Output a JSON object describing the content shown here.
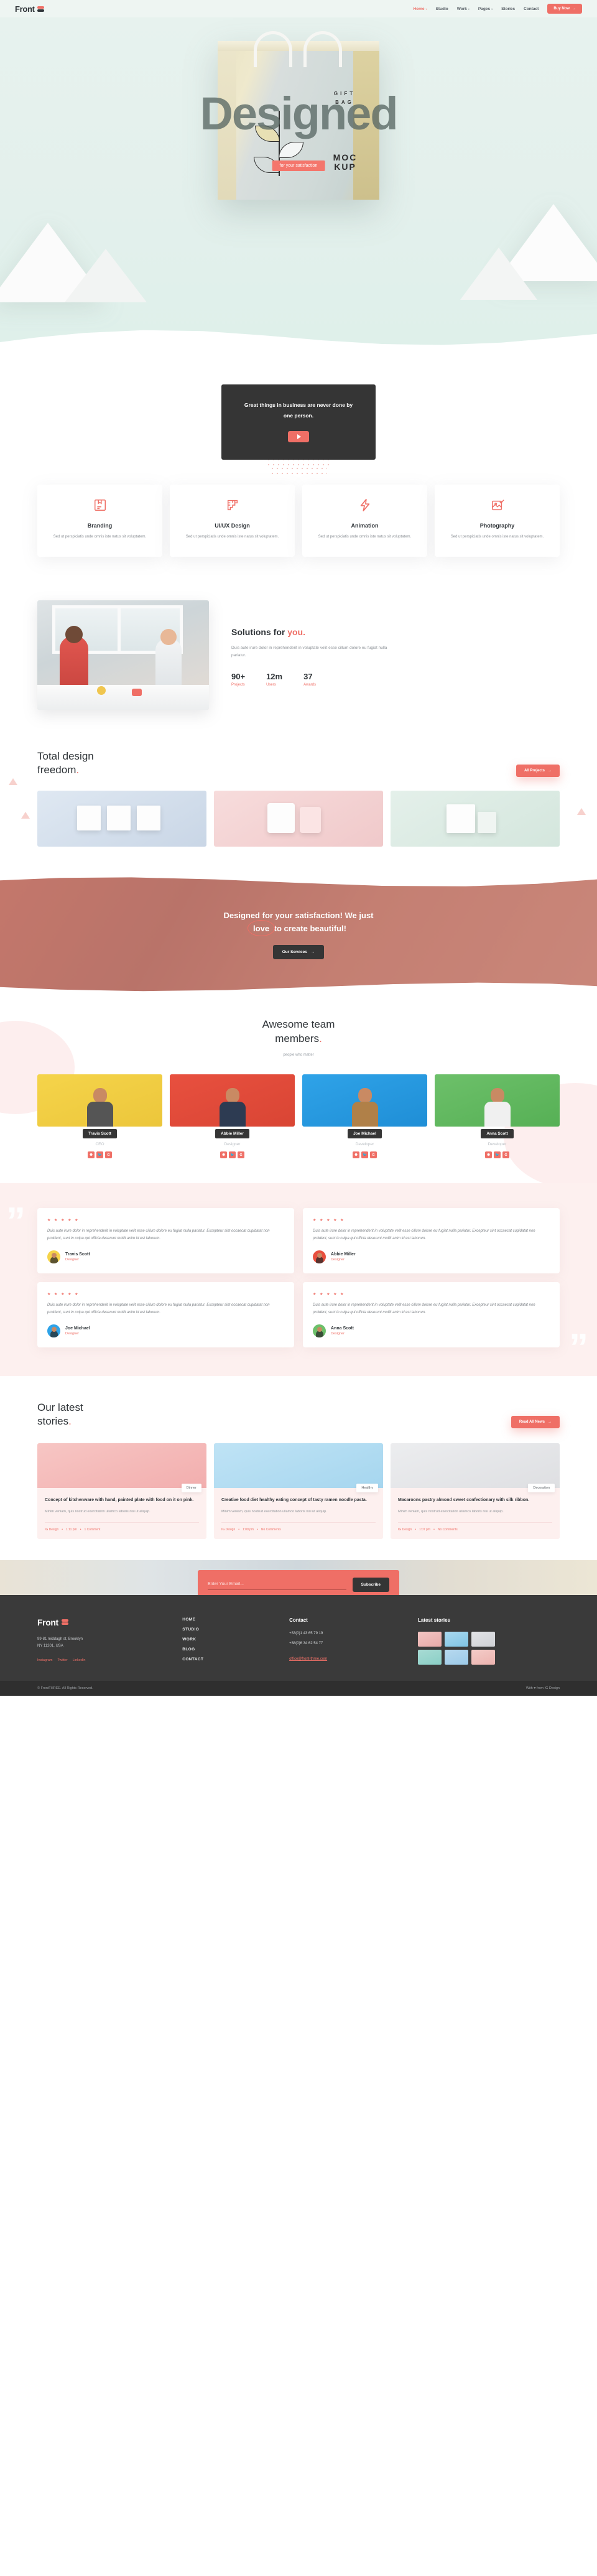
{
  "brand": {
    "name": "Front",
    "logo_icon": "stacked-bars-logo"
  },
  "nav": {
    "items": [
      {
        "label": "Home",
        "active": true,
        "has_caret": true
      },
      {
        "label": "Studio",
        "active": false,
        "has_caret": false
      },
      {
        "label": "Work",
        "active": false,
        "has_caret": true
      },
      {
        "label": "Pages",
        "active": false,
        "has_caret": true
      },
      {
        "label": "Stories",
        "active": false,
        "has_caret": false
      },
      {
        "label": "Contact",
        "active": false,
        "has_caret": false
      }
    ],
    "cta_label": "Buy Now",
    "cta_icon": "arrow-right-icon"
  },
  "hero": {
    "title": "Designed",
    "badge": "for your satisfaction",
    "bag_gift": "GIFT BAG",
    "bag_mock_line1": "MOC",
    "bag_mock_line2": "KUP"
  },
  "quote": {
    "text": "Great things in business are never done by one person.",
    "play_icon": "play-icon"
  },
  "services": [
    {
      "icon": "box-icon",
      "title": "Branding",
      "desc": "Sed ut perspiciatis unde omnis iste natus sit voluptatem."
    },
    {
      "icon": "ruler-icon",
      "title": "UI/UX Design",
      "desc": "Sed ut perspiciatis unde omnis iste natus sit voluptatem."
    },
    {
      "icon": "bolt-icon",
      "title": "Animation",
      "desc": "Sed ut perspiciatis unde omnis iste natus sit voluptatem."
    },
    {
      "icon": "image-check-icon",
      "title": "Photography",
      "desc": "Sed ut perspiciatis unde omnis iste natus sit voluptatem."
    }
  ],
  "solutions": {
    "title_plain": "Solutions for ",
    "title_accent": "you.",
    "body": "Duis aute irure dolor in reprehenderit in voluptate velit esse cillum dolore eu fugiat nulla pariatur.",
    "stats": [
      {
        "num": "90+",
        "label": "Projects"
      },
      {
        "num": "12m",
        "label": "Users"
      },
      {
        "num": "37",
        "label": "Awards"
      }
    ]
  },
  "portfolio": {
    "title_line1": "Total design",
    "title_line2": "freedom",
    "title_dot": ".",
    "button": "All Projects",
    "button_icon": "arrow-right-icon"
  },
  "banner": {
    "line1": "Designed for your satisfaction! We just",
    "love_word": "love",
    "line2_rest": " to create beautiful!",
    "button": "Our Services",
    "button_icon": "arrow-right-icon"
  },
  "team": {
    "title_line1": "Awesome team",
    "title_line2": "members",
    "title_dot": ".",
    "subtitle": "people who matter",
    "members": [
      {
        "name": "Travis Scott",
        "role": "CEO",
        "socials": [
          "dribbble-icon",
          "twitter-icon",
          "google-icon"
        ]
      },
      {
        "name": "Abbie Miller",
        "role": "Designer",
        "socials": [
          "dribbble-icon",
          "twitter-icon",
          "google-icon"
        ]
      },
      {
        "name": "Joe Michael",
        "role": "Developer",
        "socials": [
          "dribbble-icon",
          "twitter-icon",
          "google-icon"
        ]
      },
      {
        "name": "Anna Scott",
        "role": "Developer",
        "socials": [
          "dribbble-icon",
          "twitter-icon",
          "google-icon"
        ]
      }
    ]
  },
  "testimonials": [
    {
      "stars": "★ ★ ★ ★ ★",
      "text": "Duis aute irure dolor in reprehenderit in voluptate velit esse cillum dolore eu fugiat nulla pariatur. Excepteur sint occaecat cupidatat non proident, sunt in culpa qui officia deserunt mollit anim id est laborum.",
      "name": "Travis Scott",
      "role": "Designer"
    },
    {
      "stars": "★ ★ ★ ★ ★",
      "text": "Duis aute irure dolor in reprehenderit in voluptate velit esse cillum dolore eu fugiat nulla pariatur. Excepteur sint occaecat cupidatat non proident, sunt in culpa qui officia deserunt mollit anim id est laborum.",
      "name": "Abbie Miller",
      "role": "Designer"
    },
    {
      "stars": "★ ★ ★ ★ ★",
      "text": "Duis aute irure dolor in reprehenderit in voluptate velit esse cillum dolore eu fugiat nulla pariatur. Excepteur sint occaecat cupidatat non proident, sunt in culpa qui officia deserunt mollit anim id est laborum.",
      "name": "Joe Michael",
      "role": "Designer"
    },
    {
      "stars": "★ ★ ★ ★ ★",
      "text": "Duis aute irure dolor in reprehenderit in voluptate velit esse cillum dolore eu fugiat nulla pariatur. Excepteur sint occaecat cupidatat non proident, sunt in culpa qui officia deserunt mollit anim id est laborum.",
      "name": "Anna Scott",
      "role": "Designer"
    }
  ],
  "stories": {
    "title_line1": "Our latest",
    "title_line2": "stories",
    "title_dot": ".",
    "button": "Read All News",
    "button_icon": "arrow-right-icon",
    "posts": [
      {
        "tag": "Dinner",
        "title": "Concept of kitchenware with hand, painted plate with food on it on pink.",
        "excerpt": "Minim veniam, quis nostrud exercitation ullamco laboris nisi ut aliquip.",
        "author": "IG Design",
        "time": "1:11 pm",
        "comments": "1 Comment"
      },
      {
        "tag": "Healthy",
        "title": "Creative food diet healthy eating concept of tasty ramen noodle pasta.",
        "excerpt": "Minim veniam, quis nostrud exercitation ullamco laboris nisi ut aliquip.",
        "author": "IG Design",
        "time": "1:09 pm",
        "comments": "No Comments"
      },
      {
        "tag": "Decoration",
        "title": "Macaroons pastry almond sweet confectionary with silk ribbon.",
        "excerpt": "Minim veniam, quis nostrud exercitation ullamco laboris nisi ut aliquip.",
        "author": "IG Design",
        "time": "1:07 pm",
        "comments": "No Comments"
      }
    ]
  },
  "newsletter": {
    "placeholder": "Enter Your Email...",
    "value": "",
    "button": "Subscribe"
  },
  "footer": {
    "brand": "Front",
    "address_line1": "99-81 middagh st, Brooklyn",
    "address_line2": "NY 11201, USA",
    "socials": [
      "Instagram",
      "Twitter",
      "LinkedIn"
    ],
    "nav": [
      "HOME",
      "STUDIO",
      "WORK",
      "BLOG",
      "CONTACT"
    ],
    "contact_heading": "Contact",
    "phone1": "+33(0)1 43 65 79 19",
    "phone2": "+38(0)6 34 62 54 77",
    "email": "office@front-three.com",
    "stories_heading": "Latest stories",
    "thumbs": [
      "thumb-plate",
      "thumb-noodles",
      "thumb-cone",
      "thumb-sprinkle",
      "thumb-salad",
      "thumb-icecream"
    ],
    "copyright": "© FrontTHREE. All Rights Reserved.",
    "credit_prefix": "With ",
    "credit_heart": "♥",
    "credit_suffix": " from IG Design"
  },
  "colors": {
    "accent": "#ef6f66",
    "dark": "#353535",
    "hero_bg": "#e3f0ec",
    "testimonial_bg": "#fdf0ef"
  }
}
